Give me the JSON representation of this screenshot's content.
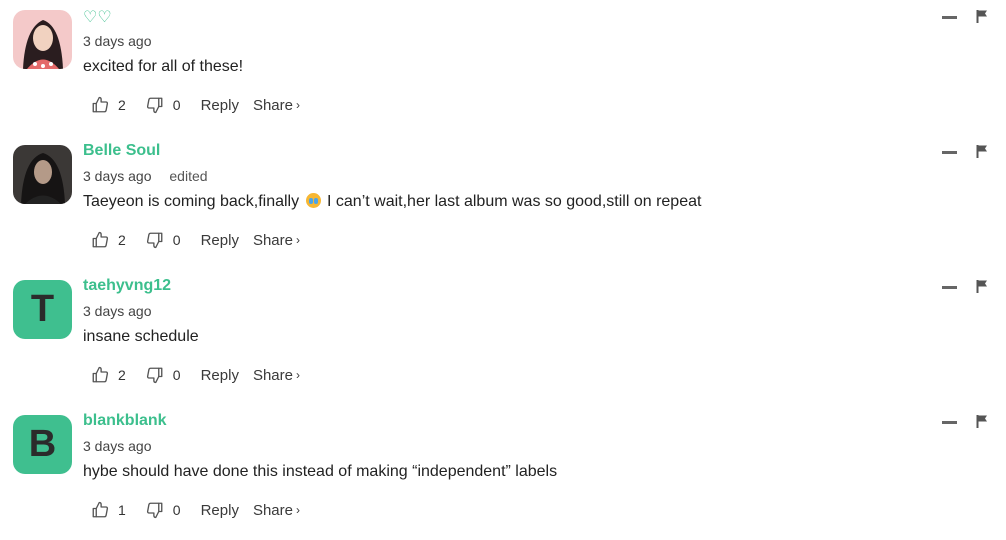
{
  "comments": [
    {
      "username": "♡♡",
      "time": "3 days ago",
      "edited": "",
      "text_before": "excited for all of these!",
      "text_after": "",
      "has_emoji": false,
      "avatar_type": "photo",
      "avatar_letter": "",
      "likes": "2",
      "dislikes": "0",
      "reply_label": "Reply",
      "share_label": "Share",
      "share_chevron": "›"
    },
    {
      "username": "Belle Soul",
      "time": "3 days ago",
      "edited": "edited",
      "text_before": "Taeyeon is coming back,finally",
      "text_after": "I can’t wait,her last album was so good,still on repeat",
      "has_emoji": true,
      "avatar_type": "photo",
      "avatar_letter": "",
      "likes": "2",
      "dislikes": "0",
      "reply_label": "Reply",
      "share_label": "Share",
      "share_chevron": "›"
    },
    {
      "username": "taehyvng12",
      "time": "3 days ago",
      "edited": "",
      "text_before": "insane schedule",
      "text_after": "",
      "has_emoji": false,
      "avatar_type": "letter",
      "avatar_letter": "T",
      "likes": "2",
      "dislikes": "0",
      "reply_label": "Reply",
      "share_label": "Share",
      "share_chevron": "›"
    },
    {
      "username": "blankblank",
      "time": "3 days ago",
      "edited": "",
      "text_before": "hybe should have done this instead of making “independent” labels",
      "text_after": "",
      "has_emoji": false,
      "avatar_type": "letter",
      "avatar_letter": "B",
      "likes": "1",
      "dislikes": "0",
      "reply_label": "Reply",
      "share_label": "Share",
      "share_chevron": "›"
    }
  ],
  "colors": {
    "username": "#3cbf8d",
    "letter_avatar_bg": "#3fbf8f"
  },
  "icons": {
    "like": "thumbs-up-icon",
    "dislike": "thumbs-down-icon",
    "collapse": "minus-icon",
    "report": "flag-icon",
    "emoji": "crying-face-emoji-icon"
  }
}
